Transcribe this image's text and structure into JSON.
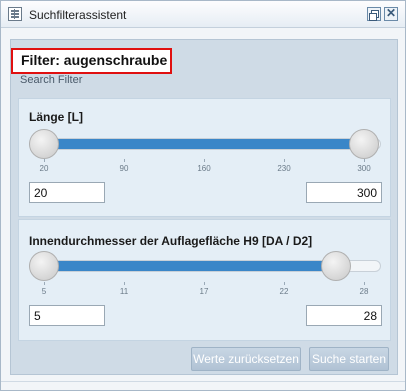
{
  "window": {
    "title": "Suchfilterassistent",
    "icons": [
      "table-icon",
      "restore-icon",
      "close-icon"
    ],
    "close_glyph": "✕"
  },
  "filter": {
    "title": "Filter: augenschraube",
    "subtitle": "Search Filter",
    "highlight_color": "#e01010"
  },
  "sliders": [
    {
      "label": "Länge [L]",
      "min": 20,
      "max": 300,
      "low": 20,
      "high": 300,
      "ticks": [
        "20",
        "90",
        "160",
        "230",
        "300"
      ],
      "input_min": "20",
      "input_max": "300"
    },
    {
      "label": "Innendurchmesser der Auflagefläche H9 [DA / D2]",
      "min": 5,
      "max": 28,
      "low": 5,
      "high": 26,
      "ticks": [
        "5",
        "11",
        "17",
        "22",
        "28"
      ],
      "input_min": "5",
      "input_max": "28"
    }
  ],
  "buttons": {
    "reset_label": "Werte zurücksetzen",
    "search_label": "Suche starten"
  },
  "colors": {
    "accent": "#3a86c8",
    "panel": "#cfdbe6",
    "section": "#e4eef6"
  }
}
